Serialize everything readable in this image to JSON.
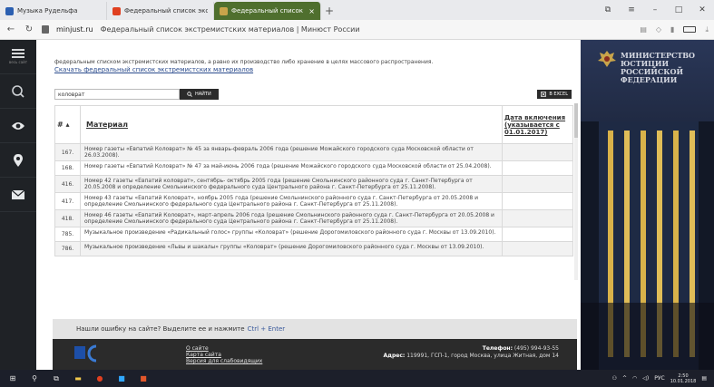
{
  "browser": {
    "tabs": [
      {
        "title": "Музыка Рудельфа",
        "icon_color": "#2b5fb1",
        "active": false
      },
      {
        "title": "Федеральный список экст",
        "icon_color": "#e04020",
        "active": false
      },
      {
        "title": "Федеральный список эк",
        "icon_color": "#c9a44a",
        "active": true
      }
    ],
    "new_tab": "+",
    "address": {
      "host": "minjust.ru",
      "title": "Федеральный список экстремистских материалов | Минюст России"
    }
  },
  "sidebar": {
    "items": [
      {
        "icon": "hamburger-icon",
        "label": "весь сайт"
      },
      {
        "icon": "search-icon",
        "label": ""
      },
      {
        "icon": "eye-icon",
        "label": ""
      },
      {
        "icon": "location-pin-icon",
        "label": ""
      },
      {
        "icon": "mail-icon",
        "label": ""
      }
    ]
  },
  "content": {
    "intro_text": "федеральным списком экстремистских материалов, а равно их производство либо хранение в целях массового распространения.",
    "download_link": "Скачать федеральный список экстремистских материалов",
    "search": {
      "value": "коловрат",
      "button": "НАЙТИ"
    },
    "excel_button": "В EXCEL",
    "table": {
      "headers": {
        "num": "#",
        "material": "Материал",
        "date": "Дата включения (указывается с 01.01.2017)"
      },
      "rows": [
        {
          "num": "167.",
          "text": "Номер газеты «Евпатий Коловрат» № 45 за январь-февраль 2006 года (решение Можайского городского суда Московской области от 26.03.2008)."
        },
        {
          "num": "168.",
          "text": "Номер газеты «Евпатий Коловрат» № 47 за май-июнь 2006 года (решение Можайского городского суда Московской области от 25.04.2008)."
        },
        {
          "num": "416.",
          "text": "Номер 42 газеты «Евпатий коловрат», сентябрь- октябрь 2005 года (решение Смольнинского районного суда г. Санкт-Петербурга от 20.05.2008 и определение Смольнинского федерального суда Центрального района г. Санкт-Петербурга от 25.11.2008)."
        },
        {
          "num": "417.",
          "text": "Номер 43 газеты «Евпатий Коловрат», ноябрь 2005 года (решение Смольнинского районного суда г. Санкт-Петербурга от 20.05.2008 и определение Смольнинского федерального суда Центрального района г. Санкт-Петербурга от 25.11.2008)."
        },
        {
          "num": "418.",
          "text": "Номер 46 газеты «Евпатий Коловрат», март-апрель 2006 года (решение Смольнинского районного суда г. Санкт-Петербурга от 20.05.2008 и определение Смольнинского федерального суда Центрального района г. Санкт-Петербурга от 25.11.2008)."
        },
        {
          "num": "785.",
          "text": "Музыкальное произведение «Радикальный голос» группы «Коловрат» (решение Дорогомиловского районного суда г. Москвы от 13.09.2010)."
        },
        {
          "num": "786.",
          "text": "Музыкальное произведение «Львы и шакалы» группы «Коловрат» (решение Дорогомиловского районного суда г. Москвы от 13.09.2010)."
        }
      ]
    }
  },
  "footer": {
    "error_text": "Нашли ошибку на сайте? Выделите ее и нажмите",
    "error_keys": "Ctrl + Enter",
    "links": [
      "О сайте",
      "Карта сайта",
      "Версия для слабовидящих"
    ],
    "phone_label": "Телефон:",
    "phone": "(495) 994-93-55",
    "address_label": "Адрес:",
    "address": "119991, ГСП-1, город Москва, улица Житная, дом 14"
  },
  "banner": {
    "ministry_name": "МИНИСТЕРСТВО ЮСТИЦИИ РОССИЙСКОЙ ФЕДЕРАЦИИ"
  },
  "taskbar": {
    "lang": "РУС",
    "time": "2:50",
    "date": "10.01.2018"
  },
  "colors": {
    "active_tab": "#4f6f2e",
    "sidebar_bg": "#1f2226",
    "link": "#2a4b8d",
    "footer_bg": "#2b2b2b",
    "taskbar_bg": "#1c1f2a"
  }
}
